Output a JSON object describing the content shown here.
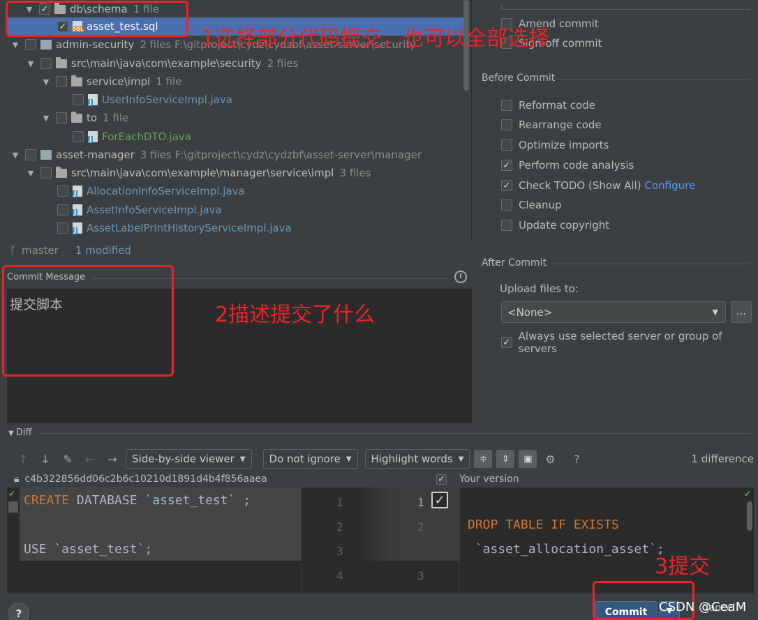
{
  "tree": {
    "rows": [
      {
        "label": "db\\schema",
        "meta": "1 file",
        "kind": "folder",
        "checked": true
      },
      {
        "label": "asset_test.sql",
        "kind": "sql",
        "checked": true
      },
      {
        "label": "admin-security",
        "meta": "2 files  F:\\gitproject\\cydz\\cydzbf\\asset-server\\security",
        "kind": "module"
      },
      {
        "label": "src\\main\\java\\com\\example\\security",
        "meta": "2 files",
        "kind": "folder"
      },
      {
        "label": "service\\impl",
        "meta": "1 file",
        "kind": "folder"
      },
      {
        "label": "UserInfoServiceImpl.java",
        "kind": "java"
      },
      {
        "label": "to",
        "meta": "1 file",
        "kind": "folder"
      },
      {
        "label": "ForEachDTO.java",
        "kind": "java-new"
      },
      {
        "label": "asset-manager",
        "meta": "3 files  F:\\gitproject\\cydz\\cydzbf\\asset-server\\manager",
        "kind": "module"
      },
      {
        "label": "src\\main\\java\\com\\example\\manager\\service\\impl",
        "meta": "3 files",
        "kind": "folder"
      },
      {
        "label": "AllocationInfoServiceImpl.java",
        "kind": "java"
      },
      {
        "label": "AssetInfoServiceImpl.java",
        "kind": "java"
      },
      {
        "label": "AssetLabelPrintHistoryServiceImpl.java",
        "kind": "java"
      }
    ]
  },
  "branch": {
    "name": "master",
    "status": "1 modified"
  },
  "commit_message": {
    "label": "Commit Message",
    "text": "提交脚本"
  },
  "right_panel": {
    "top_options": [
      "Amend commit",
      "Sign-off commit"
    ],
    "before_commit_title": "Before Commit",
    "before_options": [
      {
        "label": "Reformat code",
        "checked": false
      },
      {
        "label": "Rearrange code",
        "checked": false
      },
      {
        "label": "Optimize imports",
        "checked": false
      },
      {
        "label": "Perform code analysis",
        "checked": true
      },
      {
        "label": "Check TODO (Show All)",
        "checked": true,
        "link": "Configure"
      },
      {
        "label": "Cleanup",
        "checked": false
      },
      {
        "label": "Update copyright",
        "checked": false
      }
    ],
    "after_commit_title": "After Commit",
    "upload_label": "Upload files to:",
    "upload_value": "<None>",
    "dots_label": "...",
    "always_use_label": "Always use selected server or group of servers"
  },
  "diff": {
    "header": "Diff",
    "viewer": "Side-by-side viewer",
    "ignore": "Do not ignore",
    "highlight": "Highlight words",
    "differences": "1 difference",
    "hash": "c4b322856dd06c2b6c10210d1891d4b4f856aaea",
    "your_version": "Your version",
    "left_line1_kw": "CREATE",
    "left_line1_rest": " DATABASE `asset_test` ;",
    "left_line3": "USE `asset_test`;",
    "right_line2_a": "DROP",
    "right_line2_b": " TABLE",
    "right_line2_c": " IF",
    "right_line2_d": " EXISTS",
    "right_line3": " `asset_allocation_asset`;",
    "line_numbers_left": [
      "1",
      "2",
      "3",
      "4"
    ],
    "line_numbers_right": [
      "1",
      "2",
      "",
      "3"
    ]
  },
  "annotations": {
    "a1": "1选择部分代码提交，也可以全部选择",
    "a2": "2描述提交了什么",
    "a3": "3提交"
  },
  "buttons": {
    "commit": "Commit",
    "cancel": "Cancel",
    "help": "?"
  },
  "watermark": "CSDN @CeaM"
}
